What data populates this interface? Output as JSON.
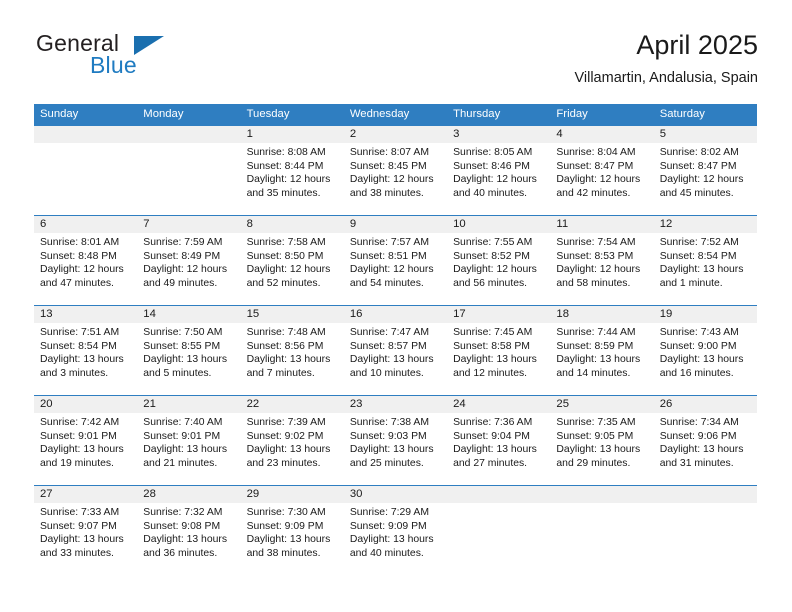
{
  "brand": {
    "name_part1": "General",
    "name_part2": "Blue",
    "triangle_icon": "blue-triangle-icon",
    "colors": {
      "general_text": "#231f20",
      "blue_text": "#1f7bc1",
      "triangle": "#1a6faf"
    }
  },
  "header": {
    "title": "April 2025",
    "subtitle": "Villamartin, Andalusia, Spain"
  },
  "theme": {
    "header_bg": "#2f7ec1",
    "header_text": "#ffffff",
    "date_strip_bg": "#f0f0f0",
    "week_divider": "#2f7ec1",
    "body_text": "#1a1a1a"
  },
  "weekdays": [
    "Sunday",
    "Monday",
    "Tuesday",
    "Wednesday",
    "Thursday",
    "Friday",
    "Saturday"
  ],
  "weeks": [
    {
      "days": [
        {
          "date": "",
          "sunrise": "",
          "sunset": "",
          "daylight_line1": "",
          "daylight_line2": ""
        },
        {
          "date": "",
          "sunrise": "",
          "sunset": "",
          "daylight_line1": "",
          "daylight_line2": ""
        },
        {
          "date": "1",
          "sunrise": "Sunrise: 8:08 AM",
          "sunset": "Sunset: 8:44 PM",
          "daylight_line1": "Daylight: 12 hours",
          "daylight_line2": "and 35 minutes."
        },
        {
          "date": "2",
          "sunrise": "Sunrise: 8:07 AM",
          "sunset": "Sunset: 8:45 PM",
          "daylight_line1": "Daylight: 12 hours",
          "daylight_line2": "and 38 minutes."
        },
        {
          "date": "3",
          "sunrise": "Sunrise: 8:05 AM",
          "sunset": "Sunset: 8:46 PM",
          "daylight_line1": "Daylight: 12 hours",
          "daylight_line2": "and 40 minutes."
        },
        {
          "date": "4",
          "sunrise": "Sunrise: 8:04 AM",
          "sunset": "Sunset: 8:47 PM",
          "daylight_line1": "Daylight: 12 hours",
          "daylight_line2": "and 42 minutes."
        },
        {
          "date": "5",
          "sunrise": "Sunrise: 8:02 AM",
          "sunset": "Sunset: 8:47 PM",
          "daylight_line1": "Daylight: 12 hours",
          "daylight_line2": "and 45 minutes."
        }
      ]
    },
    {
      "days": [
        {
          "date": "6",
          "sunrise": "Sunrise: 8:01 AM",
          "sunset": "Sunset: 8:48 PM",
          "daylight_line1": "Daylight: 12 hours",
          "daylight_line2": "and 47 minutes."
        },
        {
          "date": "7",
          "sunrise": "Sunrise: 7:59 AM",
          "sunset": "Sunset: 8:49 PM",
          "daylight_line1": "Daylight: 12 hours",
          "daylight_line2": "and 49 minutes."
        },
        {
          "date": "8",
          "sunrise": "Sunrise: 7:58 AM",
          "sunset": "Sunset: 8:50 PM",
          "daylight_line1": "Daylight: 12 hours",
          "daylight_line2": "and 52 minutes."
        },
        {
          "date": "9",
          "sunrise": "Sunrise: 7:57 AM",
          "sunset": "Sunset: 8:51 PM",
          "daylight_line1": "Daylight: 12 hours",
          "daylight_line2": "and 54 minutes."
        },
        {
          "date": "10",
          "sunrise": "Sunrise: 7:55 AM",
          "sunset": "Sunset: 8:52 PM",
          "daylight_line1": "Daylight: 12 hours",
          "daylight_line2": "and 56 minutes."
        },
        {
          "date": "11",
          "sunrise": "Sunrise: 7:54 AM",
          "sunset": "Sunset: 8:53 PM",
          "daylight_line1": "Daylight: 12 hours",
          "daylight_line2": "and 58 minutes."
        },
        {
          "date": "12",
          "sunrise": "Sunrise: 7:52 AM",
          "sunset": "Sunset: 8:54 PM",
          "daylight_line1": "Daylight: 13 hours",
          "daylight_line2": "and 1 minute."
        }
      ]
    },
    {
      "days": [
        {
          "date": "13",
          "sunrise": "Sunrise: 7:51 AM",
          "sunset": "Sunset: 8:54 PM",
          "daylight_line1": "Daylight: 13 hours",
          "daylight_line2": "and 3 minutes."
        },
        {
          "date": "14",
          "sunrise": "Sunrise: 7:50 AM",
          "sunset": "Sunset: 8:55 PM",
          "daylight_line1": "Daylight: 13 hours",
          "daylight_line2": "and 5 minutes."
        },
        {
          "date": "15",
          "sunrise": "Sunrise: 7:48 AM",
          "sunset": "Sunset: 8:56 PM",
          "daylight_line1": "Daylight: 13 hours",
          "daylight_line2": "and 7 minutes."
        },
        {
          "date": "16",
          "sunrise": "Sunrise: 7:47 AM",
          "sunset": "Sunset: 8:57 PM",
          "daylight_line1": "Daylight: 13 hours",
          "daylight_line2": "and 10 minutes."
        },
        {
          "date": "17",
          "sunrise": "Sunrise: 7:45 AM",
          "sunset": "Sunset: 8:58 PM",
          "daylight_line1": "Daylight: 13 hours",
          "daylight_line2": "and 12 minutes."
        },
        {
          "date": "18",
          "sunrise": "Sunrise: 7:44 AM",
          "sunset": "Sunset: 8:59 PM",
          "daylight_line1": "Daylight: 13 hours",
          "daylight_line2": "and 14 minutes."
        },
        {
          "date": "19",
          "sunrise": "Sunrise: 7:43 AM",
          "sunset": "Sunset: 9:00 PM",
          "daylight_line1": "Daylight: 13 hours",
          "daylight_line2": "and 16 minutes."
        }
      ]
    },
    {
      "days": [
        {
          "date": "20",
          "sunrise": "Sunrise: 7:42 AM",
          "sunset": "Sunset: 9:01 PM",
          "daylight_line1": "Daylight: 13 hours",
          "daylight_line2": "and 19 minutes."
        },
        {
          "date": "21",
          "sunrise": "Sunrise: 7:40 AM",
          "sunset": "Sunset: 9:01 PM",
          "daylight_line1": "Daylight: 13 hours",
          "daylight_line2": "and 21 minutes."
        },
        {
          "date": "22",
          "sunrise": "Sunrise: 7:39 AM",
          "sunset": "Sunset: 9:02 PM",
          "daylight_line1": "Daylight: 13 hours",
          "daylight_line2": "and 23 minutes."
        },
        {
          "date": "23",
          "sunrise": "Sunrise: 7:38 AM",
          "sunset": "Sunset: 9:03 PM",
          "daylight_line1": "Daylight: 13 hours",
          "daylight_line2": "and 25 minutes."
        },
        {
          "date": "24",
          "sunrise": "Sunrise: 7:36 AM",
          "sunset": "Sunset: 9:04 PM",
          "daylight_line1": "Daylight: 13 hours",
          "daylight_line2": "and 27 minutes."
        },
        {
          "date": "25",
          "sunrise": "Sunrise: 7:35 AM",
          "sunset": "Sunset: 9:05 PM",
          "daylight_line1": "Daylight: 13 hours",
          "daylight_line2": "and 29 minutes."
        },
        {
          "date": "26",
          "sunrise": "Sunrise: 7:34 AM",
          "sunset": "Sunset: 9:06 PM",
          "daylight_line1": "Daylight: 13 hours",
          "daylight_line2": "and 31 minutes."
        }
      ]
    },
    {
      "days": [
        {
          "date": "27",
          "sunrise": "Sunrise: 7:33 AM",
          "sunset": "Sunset: 9:07 PM",
          "daylight_line1": "Daylight: 13 hours",
          "daylight_line2": "and 33 minutes."
        },
        {
          "date": "28",
          "sunrise": "Sunrise: 7:32 AM",
          "sunset": "Sunset: 9:08 PM",
          "daylight_line1": "Daylight: 13 hours",
          "daylight_line2": "and 36 minutes."
        },
        {
          "date": "29",
          "sunrise": "Sunrise: 7:30 AM",
          "sunset": "Sunset: 9:09 PM",
          "daylight_line1": "Daylight: 13 hours",
          "daylight_line2": "and 38 minutes."
        },
        {
          "date": "30",
          "sunrise": "Sunrise: 7:29 AM",
          "sunset": "Sunset: 9:09 PM",
          "daylight_line1": "Daylight: 13 hours",
          "daylight_line2": "and 40 minutes."
        },
        {
          "date": "",
          "sunrise": "",
          "sunset": "",
          "daylight_line1": "",
          "daylight_line2": ""
        },
        {
          "date": "",
          "sunrise": "",
          "sunset": "",
          "daylight_line1": "",
          "daylight_line2": ""
        },
        {
          "date": "",
          "sunrise": "",
          "sunset": "",
          "daylight_line1": "",
          "daylight_line2": ""
        }
      ]
    }
  ]
}
